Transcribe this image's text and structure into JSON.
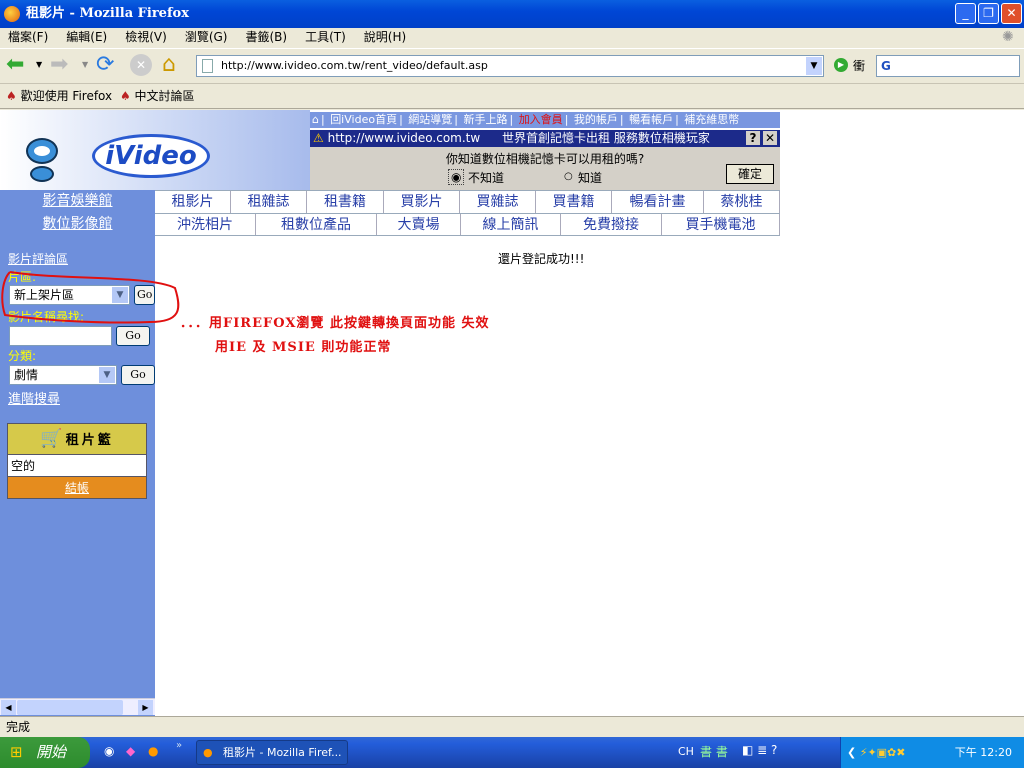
{
  "window": {
    "title": "租影片 - Mozilla Firefox"
  },
  "menu": [
    "檔案(F)",
    "編輯(E)",
    "檢視(V)",
    "瀏覽(G)",
    "書籤(B)",
    "工具(T)",
    "說明(H)"
  ],
  "toolbar": {
    "url": "http://www.ivideo.com.tw/rent_video/default.asp",
    "search_label": "衝",
    "search_placeholder": "G"
  },
  "bookmarks": [
    "歡迎使用 Firefox",
    "中文討論區"
  ],
  "site": {
    "logo": "iVideo",
    "toplinks": [
      "回iVideo首頁",
      "網站導覽",
      "新手上路",
      "加入會員",
      "我的帳戶",
      "暢看帳戶",
      "補充維思幣"
    ],
    "highlight_color": "#e01010",
    "ad_url": "http://www.ivideo.com.tw",
    "ad_text": "世界首創記憶卡出租 服務數位相機玩家",
    "poll_question": "你知道數位相機記憶卡可以用租的嗎?",
    "poll_options": [
      "不知道",
      "知道"
    ],
    "poll_submit": "確定",
    "section1": "影音娛樂館",
    "section2": "數位影像館",
    "nav1": [
      "租影片",
      "租雜誌",
      "租書籍",
      "買影片",
      "買雜誌",
      "買書籍",
      "暢看計畫",
      "蔡桃桂"
    ],
    "nav2": [
      "沖洗相片",
      "租數位產品",
      "大賣場",
      "線上簡訊",
      "免費撥接",
      "買手機電池"
    ]
  },
  "sidebar": {
    "review_link": "影片評論區",
    "zone_label": "片區:",
    "zone_value": "新上架片區",
    "go": "Go",
    "name_search_label": "影片名稱尋找:",
    "name_search_value": "",
    "category_label": "分類:",
    "category_value": "劇情",
    "advanced_link": "進階搜尋",
    "cart_title": "租片籃",
    "cart_content": "空的",
    "checkout": "結帳"
  },
  "main": {
    "message": "還片登記成功!!!",
    "note1": "．．．用FIREFOX瀏覽  此按鍵轉換頁面功能 失效",
    "note2": "用IE 及 MSIE 則功能正常"
  },
  "status": "完成",
  "taskbar": {
    "start": "開始",
    "task": "租影片 - Mozilla Firef...",
    "lang": "CH",
    "time": "下午 12:20"
  }
}
